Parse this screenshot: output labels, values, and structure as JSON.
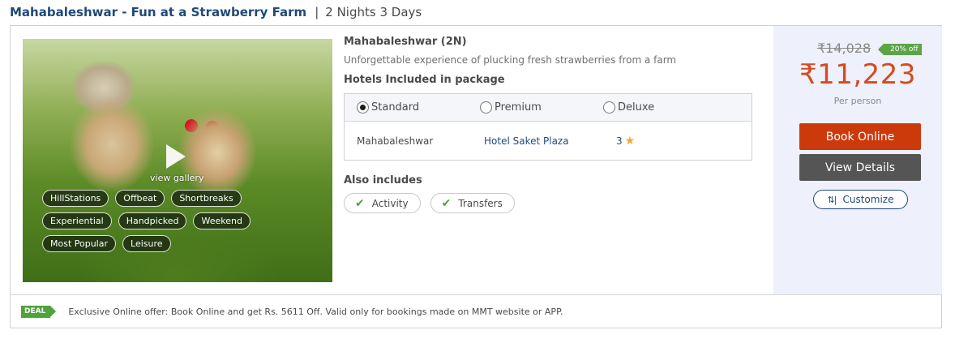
{
  "header": {
    "title": "Mahabaleshwar - Fun at a Strawberry Farm",
    "separator": "|",
    "duration": "2 Nights 3 Days"
  },
  "gallery": {
    "label": "view gallery",
    "tags": [
      [
        "HillStations",
        "Offbeat",
        "Shortbreaks"
      ],
      [
        "Experiential",
        "Handpicked",
        "Weekend"
      ],
      [
        "Most Popular",
        "Leisure"
      ]
    ]
  },
  "details": {
    "destination": "Mahabaleshwar (2N)",
    "description": "Unforgettable experience of plucking fresh strawberries from a farm",
    "hotels_heading": "Hotels Included in package",
    "options": [
      "Standard",
      "Premium",
      "Deluxe"
    ],
    "selected_option": "Standard",
    "hotel_row": {
      "city": "Mahabaleshwar",
      "hotel": "Hotel Saket Plaza",
      "rating": "3",
      "rating_icon": "star-icon"
    },
    "also_includes_heading": "Also includes",
    "includes": [
      "Activity",
      "Transfers"
    ]
  },
  "pricing": {
    "original": "₹14,028",
    "discount": "20% off",
    "price": "₹11,223",
    "per": "Per person",
    "book_label": "Book Online",
    "view_label": "View Details",
    "customize_label": "Customize",
    "price_color": "#d44b1f",
    "book_color": "#cc3a0b"
  },
  "deal": {
    "badge": "DEAL",
    "text": "Exclusive Online offer: Book Online and get Rs. 5611 Off. Valid only for bookings made on MMT website or APP."
  }
}
